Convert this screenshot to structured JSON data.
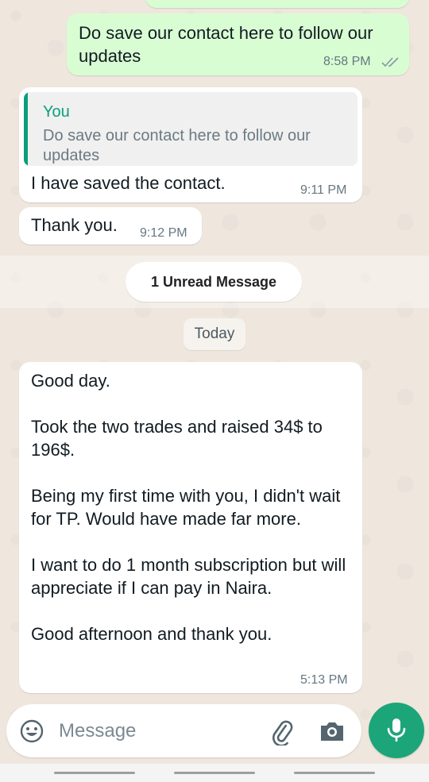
{
  "messages": {
    "msg1": {
      "text": "Do save our contact here to follow our updates",
      "time": "8:58 PM",
      "status": "read-ticks"
    },
    "msg2": {
      "quote_author": "You",
      "quote_text": "Do save our contact here to follow our updates",
      "text": "I have saved the contact.",
      "time": "9:11 PM"
    },
    "msg3": {
      "text": "Thank you.",
      "time": "9:12 PM"
    },
    "unread_label": "1 Unread Message",
    "date_label": "Today",
    "msg4": {
      "text": "Good day.\n\nTook the two trades and raised 34$ to 196$.\n\nBeing my first time with you, I didn't wait for TP. Would have made far more.\n\nI want to do 1 month subscription but will appreciate if I can pay in Naira.\n\nGood afternoon and thank you.",
      "time": "5:13 PM"
    }
  },
  "composer": {
    "placeholder": "Message",
    "icons": [
      "emoji-icon",
      "attach-icon",
      "camera-icon",
      "mic-icon"
    ]
  },
  "colors": {
    "outgoing_bubble": "#d9fdd3",
    "incoming_bubble": "#ffffff",
    "accent": "#1da57a",
    "quote_accent": "#0a9e7d"
  }
}
